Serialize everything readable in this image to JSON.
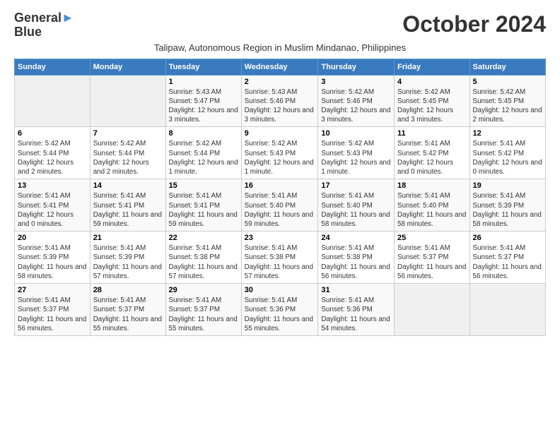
{
  "header": {
    "logo_line1": "General",
    "logo_line2": "Blue",
    "title": "October 2024",
    "subtitle": "Talipaw, Autonomous Region in Muslim Mindanao, Philippines"
  },
  "calendar": {
    "days_of_week": [
      "Sunday",
      "Monday",
      "Tuesday",
      "Wednesday",
      "Thursday",
      "Friday",
      "Saturday"
    ],
    "weeks": [
      [
        {
          "day": "",
          "info": ""
        },
        {
          "day": "",
          "info": ""
        },
        {
          "day": "1",
          "info": "Sunrise: 5:43 AM\nSunset: 5:47 PM\nDaylight: 12 hours and 3 minutes."
        },
        {
          "day": "2",
          "info": "Sunrise: 5:43 AM\nSunset: 5:46 PM\nDaylight: 12 hours and 3 minutes."
        },
        {
          "day": "3",
          "info": "Sunrise: 5:42 AM\nSunset: 5:46 PM\nDaylight: 12 hours and 3 minutes."
        },
        {
          "day": "4",
          "info": "Sunrise: 5:42 AM\nSunset: 5:45 PM\nDaylight: 12 hours and 3 minutes."
        },
        {
          "day": "5",
          "info": "Sunrise: 5:42 AM\nSunset: 5:45 PM\nDaylight: 12 hours and 2 minutes."
        }
      ],
      [
        {
          "day": "6",
          "info": "Sunrise: 5:42 AM\nSunset: 5:44 PM\nDaylight: 12 hours and 2 minutes."
        },
        {
          "day": "7",
          "info": "Sunrise: 5:42 AM\nSunset: 5:44 PM\nDaylight: 12 hours and 2 minutes."
        },
        {
          "day": "8",
          "info": "Sunrise: 5:42 AM\nSunset: 5:44 PM\nDaylight: 12 hours and 1 minute."
        },
        {
          "day": "9",
          "info": "Sunrise: 5:42 AM\nSunset: 5:43 PM\nDaylight: 12 hours and 1 minute."
        },
        {
          "day": "10",
          "info": "Sunrise: 5:42 AM\nSunset: 5:43 PM\nDaylight: 12 hours and 1 minute."
        },
        {
          "day": "11",
          "info": "Sunrise: 5:41 AM\nSunset: 5:42 PM\nDaylight: 12 hours and 0 minutes."
        },
        {
          "day": "12",
          "info": "Sunrise: 5:41 AM\nSunset: 5:42 PM\nDaylight: 12 hours and 0 minutes."
        }
      ],
      [
        {
          "day": "13",
          "info": "Sunrise: 5:41 AM\nSunset: 5:41 PM\nDaylight: 12 hours and 0 minutes."
        },
        {
          "day": "14",
          "info": "Sunrise: 5:41 AM\nSunset: 5:41 PM\nDaylight: 11 hours and 59 minutes."
        },
        {
          "day": "15",
          "info": "Sunrise: 5:41 AM\nSunset: 5:41 PM\nDaylight: 11 hours and 59 minutes."
        },
        {
          "day": "16",
          "info": "Sunrise: 5:41 AM\nSunset: 5:40 PM\nDaylight: 11 hours and 59 minutes."
        },
        {
          "day": "17",
          "info": "Sunrise: 5:41 AM\nSunset: 5:40 PM\nDaylight: 11 hours and 58 minutes."
        },
        {
          "day": "18",
          "info": "Sunrise: 5:41 AM\nSunset: 5:40 PM\nDaylight: 11 hours and 58 minutes."
        },
        {
          "day": "19",
          "info": "Sunrise: 5:41 AM\nSunset: 5:39 PM\nDaylight: 11 hours and 58 minutes."
        }
      ],
      [
        {
          "day": "20",
          "info": "Sunrise: 5:41 AM\nSunset: 5:39 PM\nDaylight: 11 hours and 58 minutes."
        },
        {
          "day": "21",
          "info": "Sunrise: 5:41 AM\nSunset: 5:39 PM\nDaylight: 11 hours and 57 minutes."
        },
        {
          "day": "22",
          "info": "Sunrise: 5:41 AM\nSunset: 5:38 PM\nDaylight: 11 hours and 57 minutes."
        },
        {
          "day": "23",
          "info": "Sunrise: 5:41 AM\nSunset: 5:38 PM\nDaylight: 11 hours and 57 minutes."
        },
        {
          "day": "24",
          "info": "Sunrise: 5:41 AM\nSunset: 5:38 PM\nDaylight: 11 hours and 56 minutes."
        },
        {
          "day": "25",
          "info": "Sunrise: 5:41 AM\nSunset: 5:37 PM\nDaylight: 11 hours and 56 minutes."
        },
        {
          "day": "26",
          "info": "Sunrise: 5:41 AM\nSunset: 5:37 PM\nDaylight: 11 hours and 56 minutes."
        }
      ],
      [
        {
          "day": "27",
          "info": "Sunrise: 5:41 AM\nSunset: 5:37 PM\nDaylight: 11 hours and 56 minutes."
        },
        {
          "day": "28",
          "info": "Sunrise: 5:41 AM\nSunset: 5:37 PM\nDaylight: 11 hours and 55 minutes."
        },
        {
          "day": "29",
          "info": "Sunrise: 5:41 AM\nSunset: 5:37 PM\nDaylight: 11 hours and 55 minutes."
        },
        {
          "day": "30",
          "info": "Sunrise: 5:41 AM\nSunset: 5:36 PM\nDaylight: 11 hours and 55 minutes."
        },
        {
          "day": "31",
          "info": "Sunrise: 5:41 AM\nSunset: 5:36 PM\nDaylight: 11 hours and 54 minutes."
        },
        {
          "day": "",
          "info": ""
        },
        {
          "day": "",
          "info": ""
        }
      ]
    ]
  }
}
